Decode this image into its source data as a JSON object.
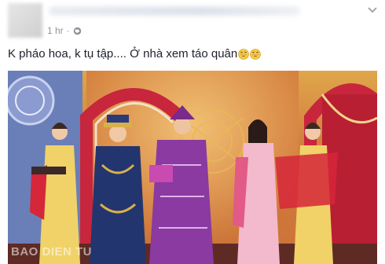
{
  "post": {
    "timestamp": "1 hr",
    "separator": "·",
    "caption": "K pháo hoa, k tụ tập.... Ở nhà xem táo quân",
    "emoji_icon": "grinning-face-icon",
    "privacy_icon": "globe-icon",
    "menu_icon": "chevron-down-icon"
  },
  "photo": {
    "watermark": "BAO DIEN TU"
  }
}
